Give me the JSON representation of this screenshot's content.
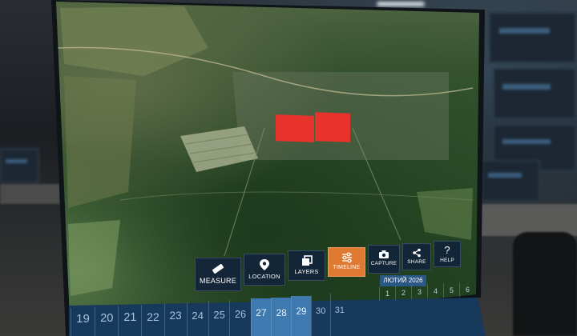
{
  "toolbar": {
    "buttons": [
      {
        "label": "MEASURE",
        "icon": "ruler-icon",
        "active": false
      },
      {
        "label": "LOCATION",
        "icon": "location-pin-icon",
        "active": false
      },
      {
        "label": "LAYERS",
        "icon": "layers-icon",
        "active": false
      },
      {
        "label": "TIMELINE",
        "icon": "sliders-icon",
        "active": true
      },
      {
        "label": "CAPTURE",
        "icon": "camera-icon",
        "active": false
      },
      {
        "label": "SHARE",
        "icon": "share-icon",
        "active": false
      },
      {
        "label": "HELP",
        "icon": "question-icon",
        "active": false
      }
    ]
  },
  "timeline": {
    "month": "ЛЮТИЙ 2026",
    "days_large": [
      "19",
      "20",
      "21",
      "22",
      "23",
      "24",
      "25",
      "26",
      "27",
      "28",
      "29",
      "30",
      "31"
    ],
    "days_small": [
      "1",
      "2",
      "3",
      "4",
      "5",
      "6"
    ],
    "selected_days": [
      "27",
      "28",
      "29"
    ]
  },
  "colors": {
    "marker": "#e8322c",
    "toolbar_bg": "#12243a",
    "active_button": "#e07a33",
    "timeline_bg": "#173a5c",
    "selected_day": "#3e7ab0"
  }
}
